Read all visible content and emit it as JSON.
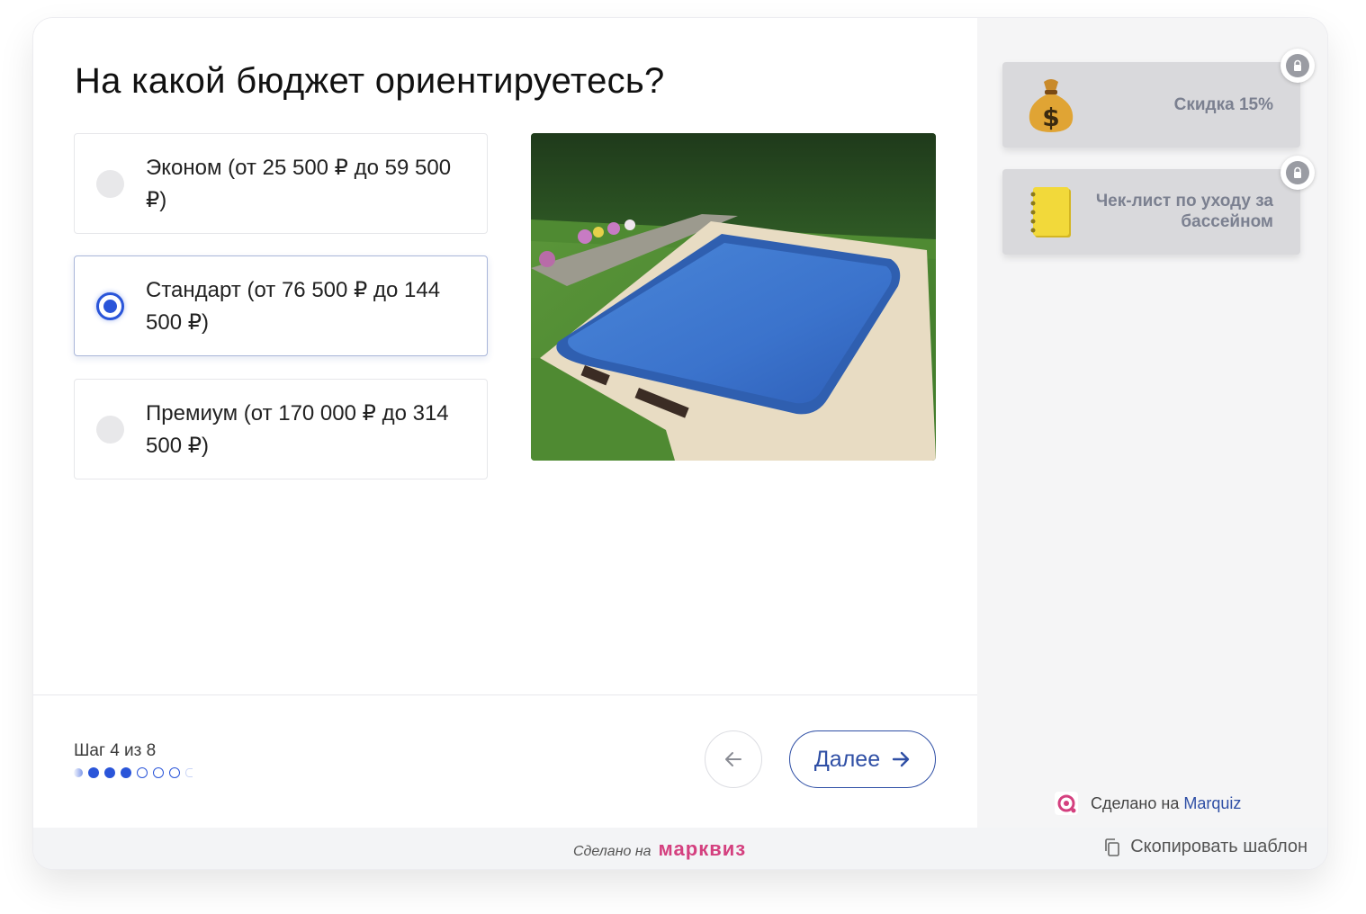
{
  "question": {
    "title": "На какой бюджет ориентируетесь?"
  },
  "options": [
    {
      "label": "Эконом (от 25 500 ₽ до 59 500 ₽)",
      "selected": false
    },
    {
      "label": "Стандарт (от 76 500 ₽ до 144 500 ₽)",
      "selected": true
    },
    {
      "label": "Премиум (от 170 000 ₽ до 314 500 ₽)",
      "selected": false
    }
  ],
  "progress": {
    "step_text": "Шаг 4 из 8",
    "current_step": 4,
    "total_steps": 8
  },
  "navigation": {
    "next_label": "Далее"
  },
  "bonuses": [
    {
      "title": "Скидка 15%",
      "icon": "money-bag-icon",
      "locked": true
    },
    {
      "title": "Чек-лист по уходу за бассейном",
      "icon": "notebook-icon",
      "locked": true
    }
  ],
  "sidebar_footer": {
    "made_text": "Сделано на",
    "brand_link": "Marquiz"
  },
  "bottom_bar": {
    "made_text": "Сделано на",
    "brand": "марквиз",
    "copy_label": "Скопировать шаблон"
  },
  "colors": {
    "accent": "#2a55d9",
    "next_button": "#2f4fa5",
    "brand_pink": "#d4407f"
  }
}
